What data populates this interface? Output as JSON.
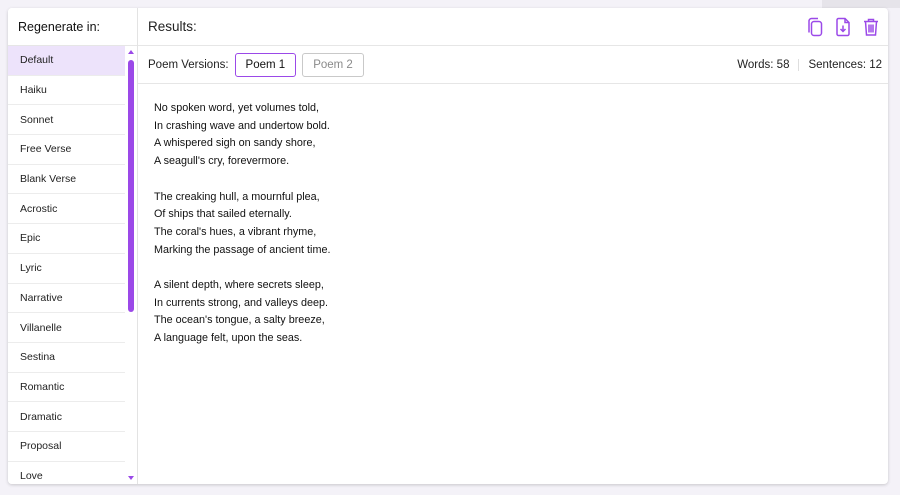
{
  "sidebar": {
    "title": "Regenerate in:",
    "items": [
      {
        "label": "Default",
        "selected": true
      },
      {
        "label": "Haiku"
      },
      {
        "label": "Sonnet"
      },
      {
        "label": "Free Verse"
      },
      {
        "label": "Blank Verse"
      },
      {
        "label": "Acrostic"
      },
      {
        "label": "Epic"
      },
      {
        "label": "Lyric"
      },
      {
        "label": "Narrative"
      },
      {
        "label": "Villanelle"
      },
      {
        "label": "Sestina"
      },
      {
        "label": "Romantic"
      },
      {
        "label": "Dramatic"
      },
      {
        "label": "Proposal"
      },
      {
        "label": "Love"
      }
    ]
  },
  "main": {
    "title": "Results:",
    "icons": [
      "copy-icon",
      "download-icon",
      "trash-icon"
    ],
    "versions_label": "Poem Versions:",
    "versions": [
      {
        "label": "Poem 1",
        "active": true
      },
      {
        "label": "Poem 2",
        "active": false
      }
    ],
    "stats": {
      "words": "Words: 58",
      "sentences": "Sentences: 12"
    },
    "poem": {
      "stanzas": [
        [
          "No spoken word, yet volumes told,",
          "In crashing wave and undertow bold.",
          "A whispered sigh on sandy shore,",
          "A seagull's cry, forevermore."
        ],
        [
          "The creaking hull, a mournful plea,",
          "Of ships that sailed eternally.",
          "The coral's hues, a vibrant rhyme,",
          "Marking the passage of ancient time."
        ],
        [
          "A silent depth, where secrets sleep,",
          "In currents strong, and valleys deep.",
          "The ocean's tongue, a salty breeze,",
          "A language felt, upon the seas."
        ]
      ]
    }
  },
  "colors": {
    "accent": "#9b49e8",
    "selected_bg": "#ede3fb"
  }
}
